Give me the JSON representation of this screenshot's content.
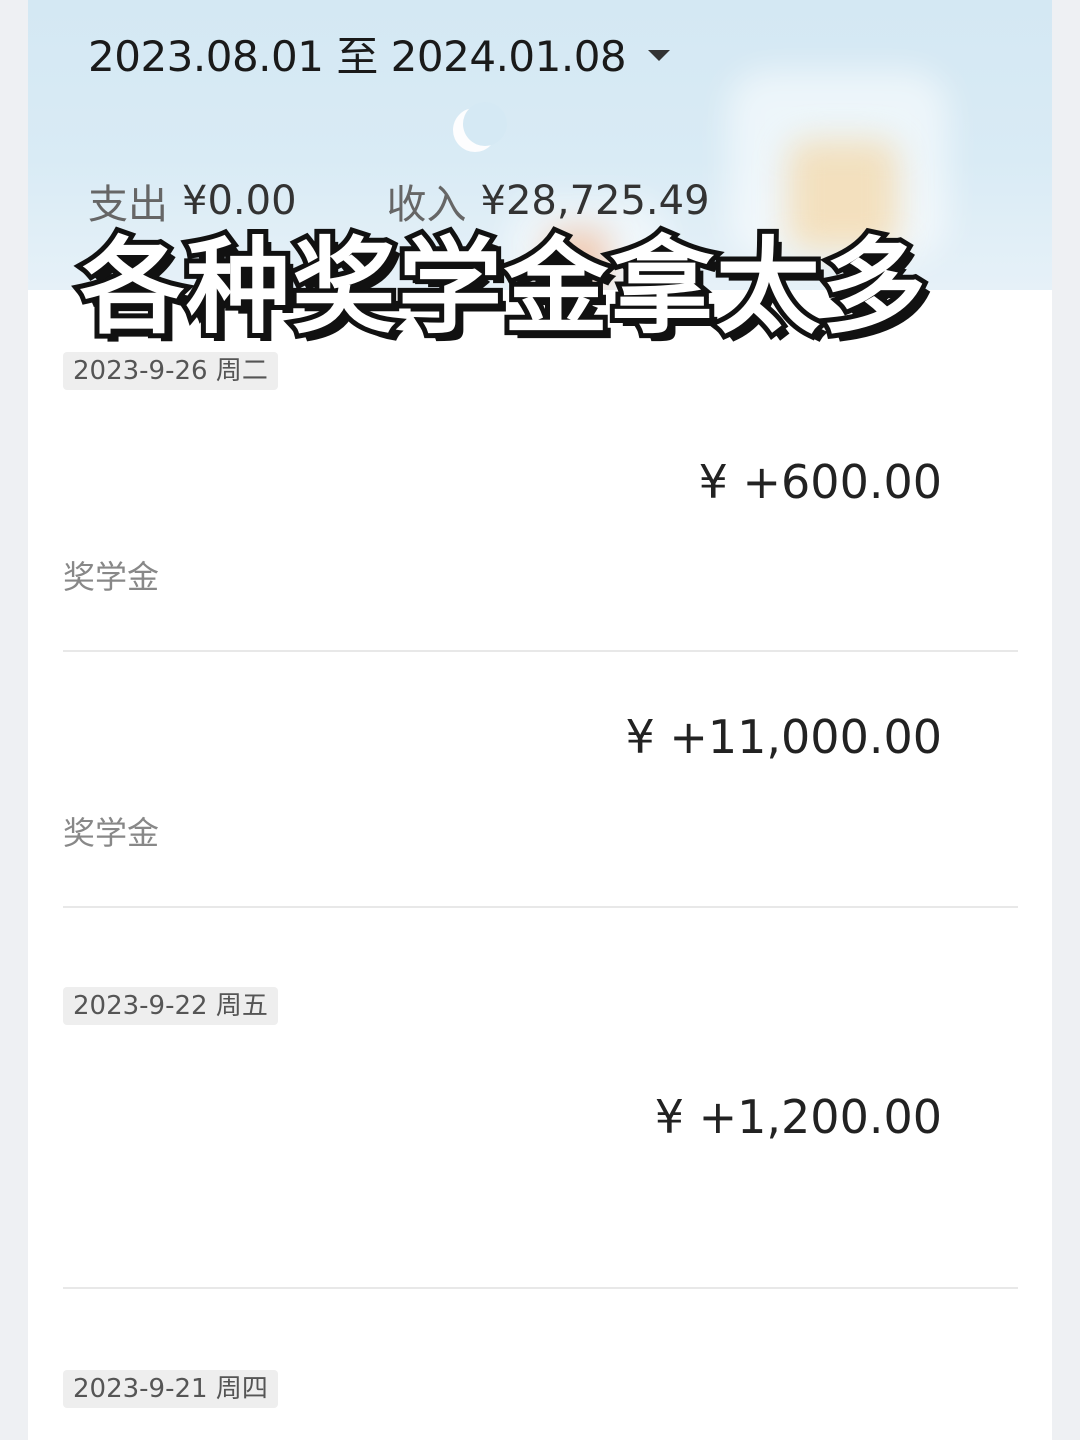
{
  "header": {
    "date_range": "2023.08.01 至 2024.01.08",
    "expense_label": "支出",
    "expense_value": "¥0.00",
    "income_label": "收入",
    "income_value": "¥28,725.49"
  },
  "overlay_title": "各种奖学金拿太多",
  "groups": [
    {
      "date": "2023-9-26 周二",
      "transactions": [
        {
          "amount": "¥ +600.00",
          "category": "奖学金"
        },
        {
          "amount": "¥ +11,000.00",
          "category": "奖学金"
        }
      ]
    },
    {
      "date": "2023-9-22 周五",
      "transactions": [
        {
          "amount": "¥ +1,200.00",
          "category": ""
        }
      ]
    },
    {
      "date": "2023-9-21 周四",
      "transactions": []
    }
  ]
}
